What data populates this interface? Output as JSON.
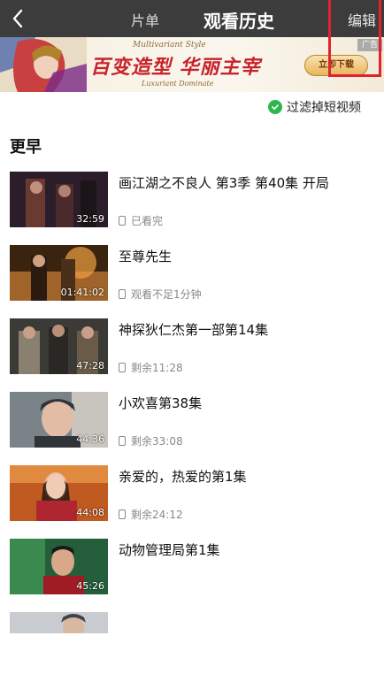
{
  "header": {
    "tab_left": "片单",
    "title": "观看历史",
    "edit_label": "编辑"
  },
  "ad": {
    "subtitle_top": "Multivariant Style",
    "headline": "百变造型 华丽主宰",
    "subtitle_bottom": "Luxuriant Dominate",
    "cta": "立即下载",
    "tag": "广告"
  },
  "filter": {
    "label": "过滤掉短视频",
    "checked": true
  },
  "section_title": "更早",
  "videos": [
    {
      "title": "画江湖之不良人 第3季 第40集 开局",
      "duration": "32:59",
      "status": "已看完",
      "thumb_colors": [
        "#2b1e2a",
        "#6a3a32",
        "#1b1418"
      ]
    },
    {
      "title": "至尊先生",
      "duration": "01:41:02",
      "status": "观看不足1分钟",
      "thumb_colors": [
        "#3a2410",
        "#a0642a",
        "#f0a040"
      ]
    },
    {
      "title": "神探狄仁杰第一部第14集",
      "duration": "47:28",
      "status": "剩余11:28",
      "thumb_colors": [
        "#3c3a36",
        "#8a8070",
        "#2a2824"
      ]
    },
    {
      "title": "小欢喜第38集",
      "duration": "44:36",
      "status": "剩余33:08",
      "thumb_colors": [
        "#7a8488",
        "#c8c4be",
        "#303438"
      ]
    },
    {
      "title": "亲爱的，热爱的第1集",
      "duration": "44:08",
      "status": "剩余24:12",
      "thumb_colors": [
        "#c05a20",
        "#e8c0a8",
        "#b02630"
      ]
    },
    {
      "title": "动物管理局第1集",
      "duration": "45:26",
      "status": "",
      "thumb_colors": [
        "#245e3a",
        "#3a8a50",
        "#a01c24"
      ]
    },
    {
      "title": "",
      "duration": "",
      "status": "",
      "thumb_colors": [
        "#c8ccd0",
        "#9aa2a8",
        "#40444a"
      ]
    }
  ],
  "colors": {
    "accent_check": "#2db84d",
    "highlight_box": "#e0232f",
    "topbar_bg": "#3c3c3c"
  }
}
